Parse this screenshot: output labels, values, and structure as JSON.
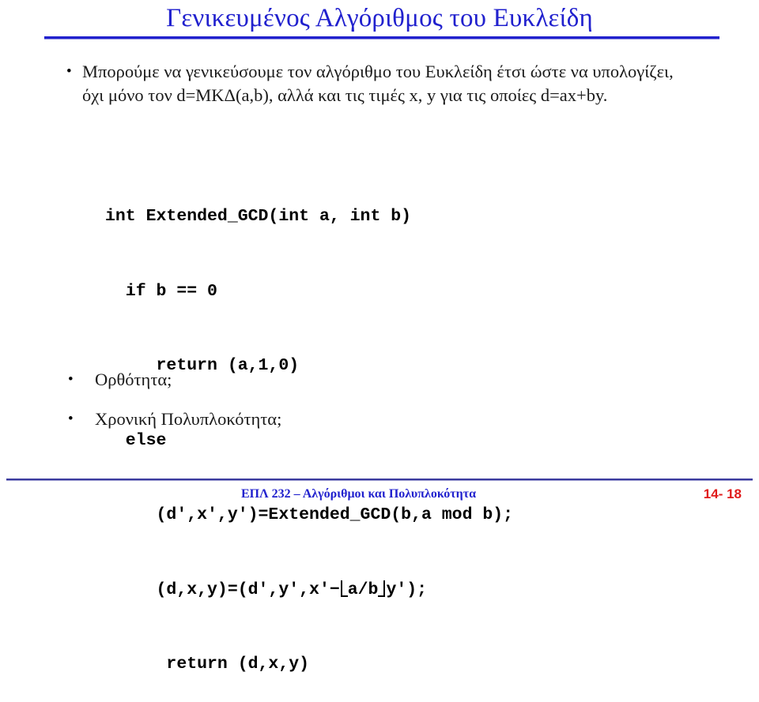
{
  "slide": {
    "title": "Γενικευμένος Αλγόριθμος του Ευκλείδη",
    "title_color": "#2121CE",
    "rule_color": "#2121CE"
  },
  "bullets": [
    {
      "marker": "•",
      "text": "Μπορούμε να γενικεύσουμε τον αλγόριθμο του Ευκλείδη έτσι ώστε να υπολογίζει, όχι μόνο τον d=ΜΚΔ(a,b), αλλά και τις τιμές x, y για τις οποίες d=ax+by."
    },
    {
      "marker": "•",
      "text": "Ορθότητα;"
    },
    {
      "marker": "•",
      "text": "Χρονική Πολυπλοκότητα;"
    }
  ],
  "code": {
    "lines": [
      "int Extended_GCD(int a, int b)",
      "  if b == 0",
      "     return (a,1,0)",
      "  else",
      "     (d′,x′,y′)=Extended_GCD(b,a mod b);",
      "     (d,x,y)=(d′,y′,x′−⌊a/b⌋y′);",
      "      return (d,x,y)"
    ],
    "line6_parts": {
      "before_floor": "     (d,x,y)=(d′,y′,x′−",
      "floor_content": "a/b",
      "after_floor": "y′);"
    }
  },
  "footer": {
    "course": "ΕΠΛ 232 – Αλγόριθμοι και Πολυπλοκότητα",
    "course_color": "#2121CE",
    "page": "14- 18",
    "page_color": "#E01B1B"
  }
}
